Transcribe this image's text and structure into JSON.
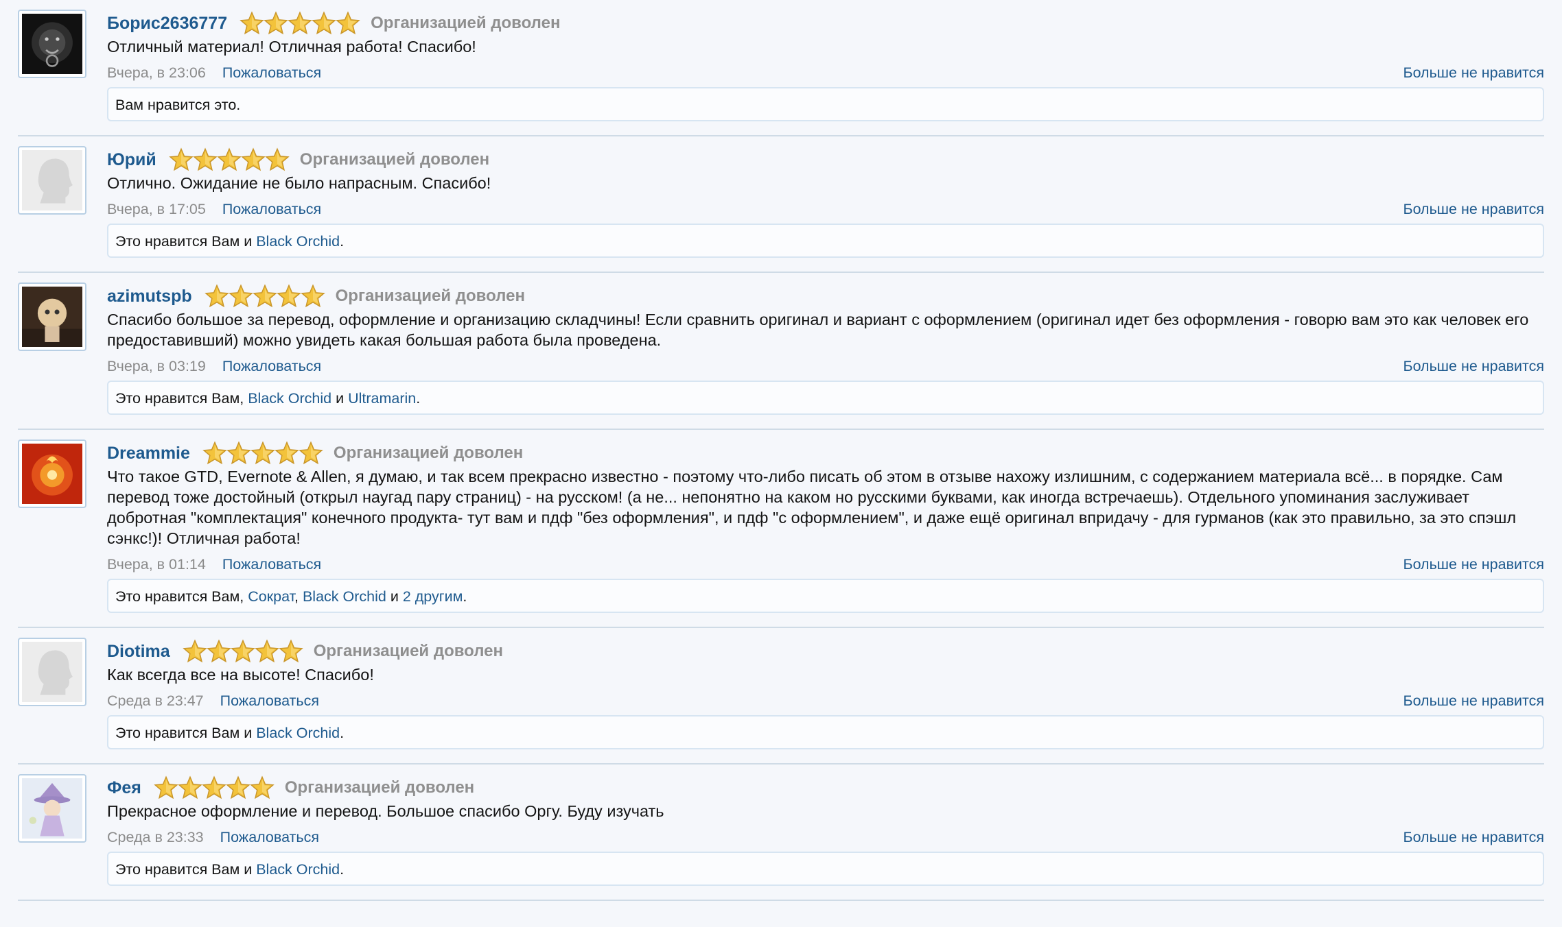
{
  "reviews": [
    {
      "user": "Борис2636777",
      "avatar": "lion-avatar",
      "stars": 5,
      "status": "Организацией доволен",
      "text": "Отличный материал! Отличная работа! Спасибо!",
      "date": "Вчера, в 23:06",
      "report": "Пожаловаться",
      "unlike": "Больше не нравится",
      "likes": [
        {
          "t": "Вам нравится это.",
          "link": false
        }
      ]
    },
    {
      "user": "Юрий",
      "avatar": "default-avatar",
      "stars": 5,
      "status": "Организацией доволен",
      "text": "Отлично. Ожидание не было напрасным. Спасибо!",
      "date": "Вчера, в 17:05",
      "report": "Пожаловаться",
      "unlike": "Больше не нравится",
      "likes": [
        {
          "t": "Это нравится Вам и ",
          "link": false
        },
        {
          "t": "Black Orchid",
          "link": true
        },
        {
          "t": ".",
          "link": false
        }
      ]
    },
    {
      "user": "azimutspb",
      "avatar": "doll-avatar",
      "stars": 5,
      "status": "Организацией доволен",
      "text": "Спасибо большое за перевод, оформление и организацию складчины! Если сравнить оригинал и вариант с оформлением (оригинал идет без оформления - говорю вам это как человек его предоставивший) можно увидеть какая большая работа была проведена.",
      "date": "Вчера, в 03:19",
      "report": "Пожаловаться",
      "unlike": "Больше не нравится",
      "likes": [
        {
          "t": "Это нравится Вам, ",
          "link": false
        },
        {
          "t": "Black Orchid",
          "link": true
        },
        {
          "t": " и ",
          "link": false
        },
        {
          "t": "Ultramarin",
          "link": true
        },
        {
          "t": ".",
          "link": false
        }
      ]
    },
    {
      "user": "Dreammie",
      "avatar": "phoenix-avatar",
      "stars": 5,
      "status": "Организацией доволен",
      "text": "Что такое GTD, Evernote & Allen, я думаю, и так всем прекрасно известно - поэтому что-либо писать об этом в отзыве нахожу излишним, с содержанием материала всё... в порядке. Сам перевод тоже достойный (открыл наугад пару страниц) - на русском! (а не... непонятно на каком но русскими буквами, как иногда встречаешь). Отдельного упоминания заслуживает добротная \"комплектация\" конечного продукта- тут вам и пдф \"без оформления\", и пдф \"с оформлением\", и даже ещё оригинал впридачу - для гурманов (как это правильно, за это спэшл сэнкс!)! Отличная работа!",
      "date": "Вчера, в 01:14",
      "report": "Пожаловаться",
      "unlike": "Больше не нравится",
      "likes": [
        {
          "t": "Это нравится Вам, ",
          "link": false
        },
        {
          "t": "Сократ",
          "link": true
        },
        {
          "t": ", ",
          "link": false
        },
        {
          "t": "Black Orchid",
          "link": true
        },
        {
          "t": " и ",
          "link": false
        },
        {
          "t": "2 другим",
          "link": true
        },
        {
          "t": ".",
          "link": false
        }
      ]
    },
    {
      "user": "Diotima",
      "avatar": "default-avatar",
      "stars": 5,
      "status": "Организацией доволен",
      "text": "Как всегда все на высоте! Спасибо!",
      "date": "Среда в 23:47",
      "report": "Пожаловаться",
      "unlike": "Больше не нравится",
      "likes": [
        {
          "t": "Это нравится Вам и ",
          "link": false
        },
        {
          "t": "Black Orchid",
          "link": true
        },
        {
          "t": ".",
          "link": false
        }
      ]
    },
    {
      "user": "Фея",
      "avatar": "fairy-avatar",
      "stars": 5,
      "status": "Организацией доволен",
      "text": "Прекрасное оформление и перевод. Большое спасибо Оргу. Буду изучать",
      "date": "Среда в 23:33",
      "report": "Пожаловаться",
      "unlike": "Больше не нравится",
      "likes": [
        {
          "t": "Это нравится Вам и ",
          "link": false
        },
        {
          "t": "Black Orchid",
          "link": true
        },
        {
          "t": ".",
          "link": false
        }
      ]
    }
  ],
  "colors": {
    "link": "#1e5a8e",
    "muted": "#8b8b8b",
    "divider": "#cfdbe6",
    "background": "#f5f7fb",
    "star": "#f3c33b"
  }
}
